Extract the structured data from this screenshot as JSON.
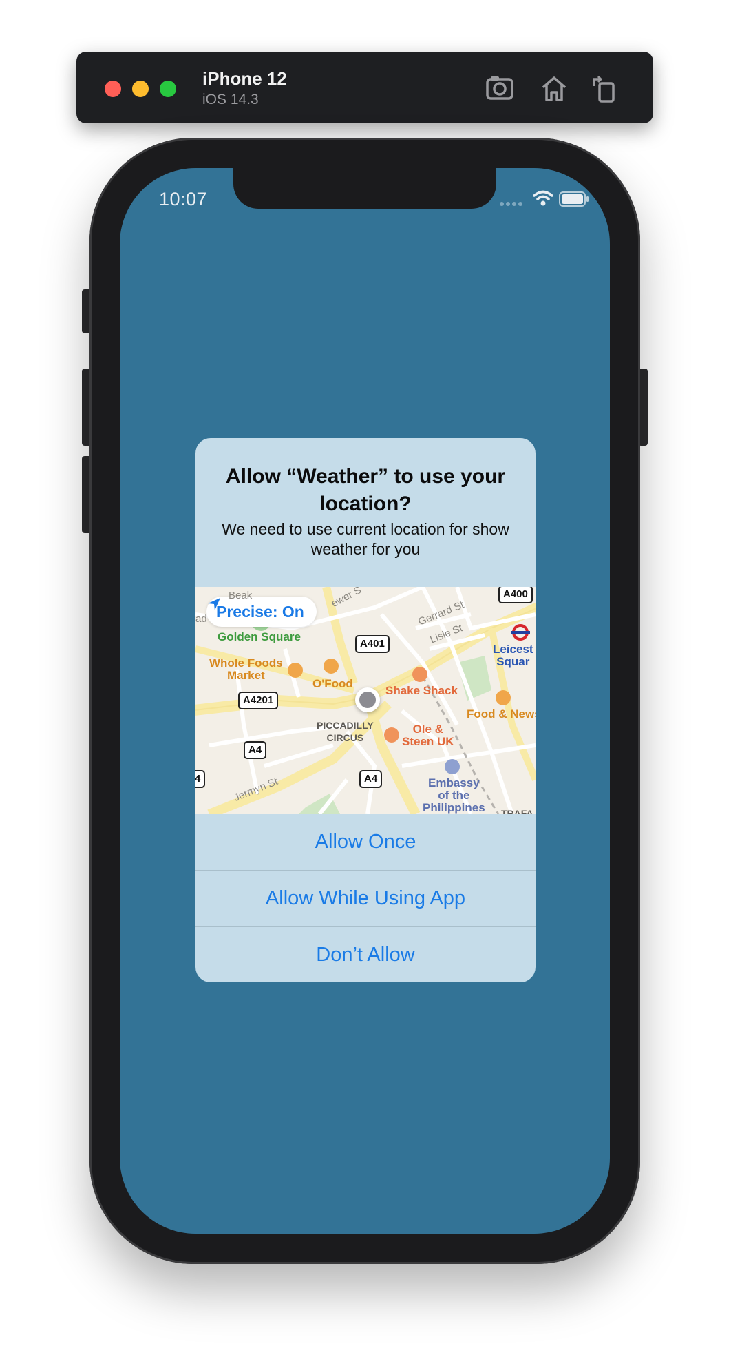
{
  "simulator": {
    "device_name": "iPhone 12",
    "os_version": "iOS 14.3",
    "icons": [
      "screenshot-icon",
      "home-icon",
      "rotate-icon"
    ]
  },
  "status_bar": {
    "time": "10:07",
    "icons": [
      "cellular-signal-icon",
      "wifi-icon",
      "battery-icon"
    ]
  },
  "alert": {
    "title": "Allow “Weather” to use your location?",
    "message": "We need to use current location for show weather for you",
    "precise_label": "Precise: On",
    "buttons": {
      "allow_once": "Allow Once",
      "allow_while_using": "Allow While Using App",
      "dont_allow": "Don’t Allow"
    }
  },
  "map": {
    "places": {
      "golden_square": "Golden Square",
      "whole_foods_1": "Whole Foods",
      "whole_foods_2": "Market",
      "ofood": "O'Food",
      "shake_shack": "Shake Shack",
      "piccadilly_1": "PICCADILLY",
      "piccadilly_2": "CIRCUS",
      "ole_1": "Ole &",
      "ole_2": "Steen UK",
      "leicester_1": "Leicest",
      "leicester_2": "Squar",
      "food_news": "Food & News",
      "embassy_1": "Embassy",
      "embassy_2": "of the",
      "embassy_3": "Philippines",
      "trafalgar": "TRAFA"
    },
    "streets": {
      "gerrard": "Gerrard St",
      "lisle": "Lisle St",
      "jermyn": "Jermyn St",
      "brewer": "ewer S",
      "beak": "Beak",
      "left_cut": "ad"
    },
    "roads": {
      "a400": "A400",
      "a401": "A401",
      "a4201": "A4201",
      "a4_upper": "A4",
      "a4_left": "4",
      "a4_lower": "A4"
    }
  },
  "colors": {
    "screen_background": "#337396",
    "alert_background": "#c5dce9",
    "button_text": "#1a7be6"
  }
}
